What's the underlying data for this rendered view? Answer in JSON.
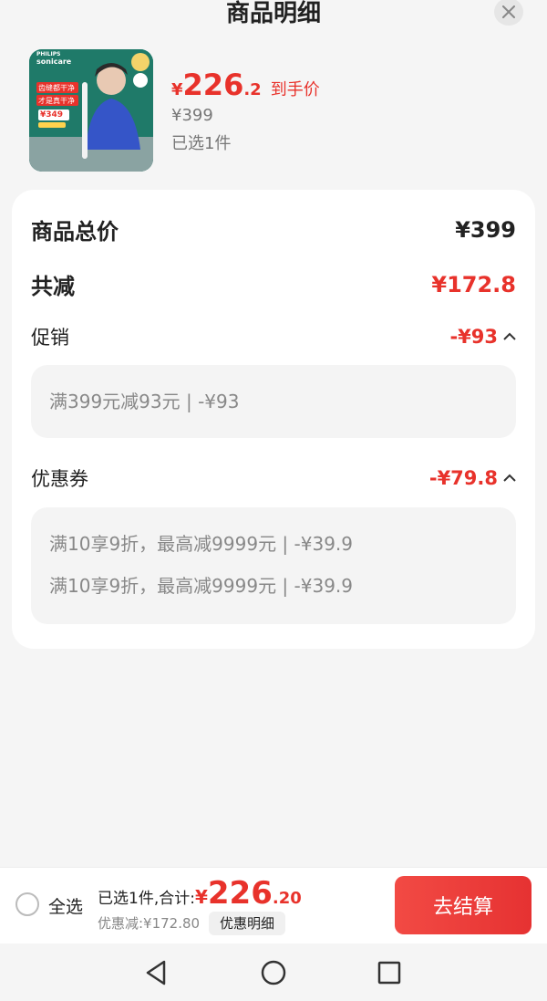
{
  "header": {
    "title": "商品明细"
  },
  "product": {
    "price_yen": "¥",
    "price_int": "226",
    "price_dec": ".2",
    "price_tag": "到手价",
    "original_price": "¥399",
    "selected": "已选1件",
    "image": {
      "brand": "PHILIPS",
      "sub_brand": "sonicare",
      "slogan1": "齿缝都干净",
      "slogan2": "才是真干净",
      "price_badge": "¥349"
    }
  },
  "summary": {
    "total_label": "商品总价",
    "total_value": "¥399",
    "reduce_label": "共减",
    "reduce_value": "¥172.8",
    "promo": {
      "label": "促销",
      "value": "-¥93",
      "items": [
        "满399元减93元 | -¥93"
      ]
    },
    "coupon": {
      "label": "优惠券",
      "value": "-¥79.8",
      "items": [
        "满10享9折，最高减9999元 | -¥39.9",
        "满10享9折，最高减9999元 | -¥39.9"
      ]
    }
  },
  "bottom": {
    "select_all": "全选",
    "summary_label": "已选1件,合计:",
    "total_yen": "¥",
    "total_int": "226",
    "total_dec": ".20",
    "discount": "优惠减:¥172.80",
    "detail_chip": "优惠明细",
    "checkout": "去结算"
  },
  "colors": {
    "accent": "#e8322b",
    "card_bg": "#ffffff",
    "page_bg": "#f5f5f5"
  },
  "icons": [
    "close-icon",
    "chevron-up-icon",
    "back-icon",
    "home-icon",
    "recents-icon"
  ]
}
